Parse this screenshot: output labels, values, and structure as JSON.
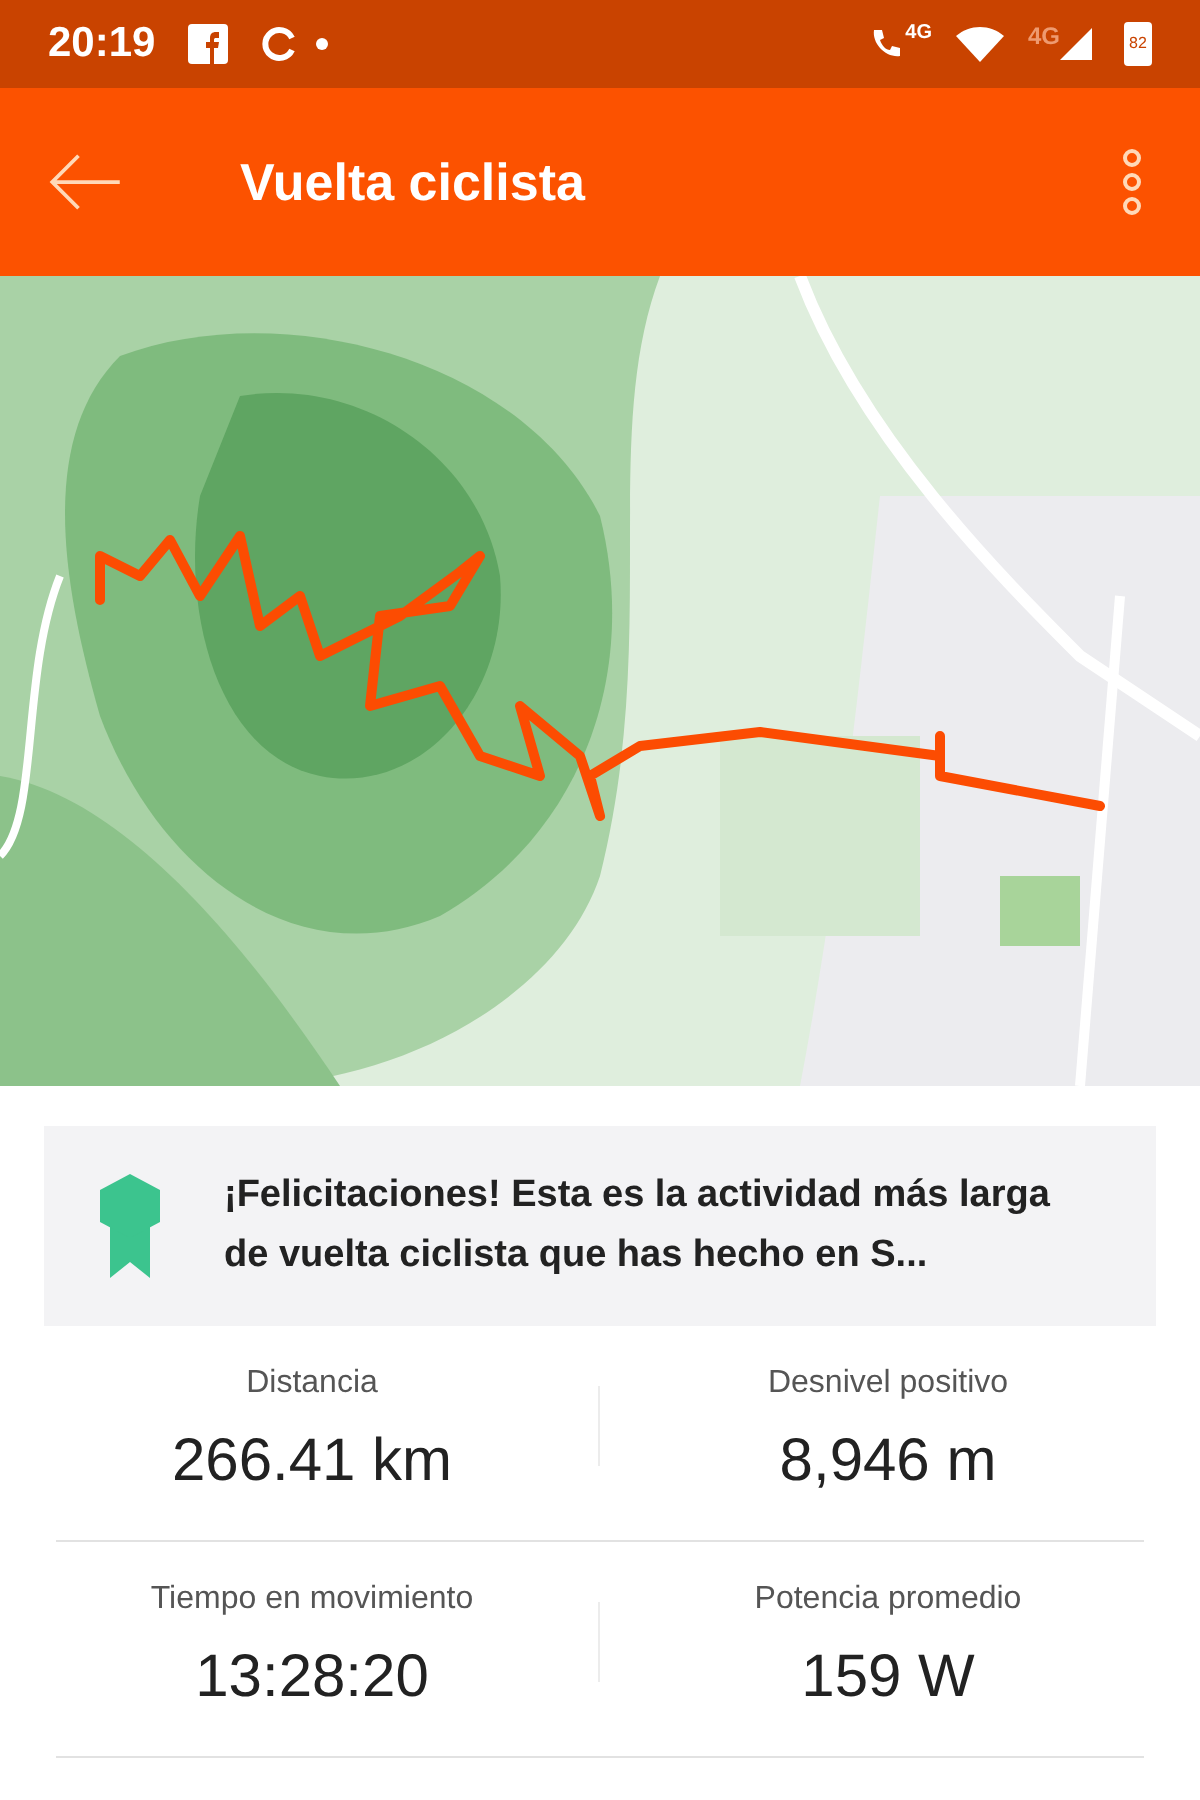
{
  "status_bar": {
    "time": "20:19",
    "call_network": "4G",
    "mobile_network": "4G",
    "battery": "82"
  },
  "app_bar": {
    "title": "Vuelta ciclista"
  },
  "achievement": {
    "text": "¡Felicitaciones! Esta es la actividad más larga de vuelta ciclista que has hecho en S..."
  },
  "stats": [
    {
      "label": "Distancia",
      "value": "266.41 km"
    },
    {
      "label": "Desnivel positivo",
      "value": "8,946 m"
    },
    {
      "label": "Tiempo en movimiento",
      "value": "13:28:20"
    },
    {
      "label": "Potencia promedio",
      "value": "159 W"
    }
  ]
}
